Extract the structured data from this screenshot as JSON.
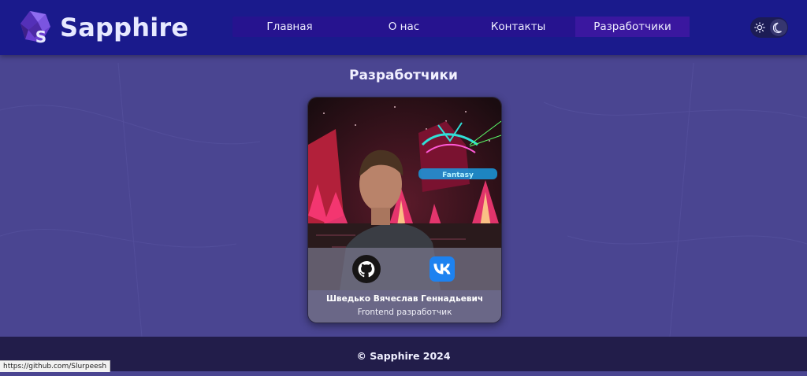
{
  "app": {
    "name": "Sapphire"
  },
  "nav": {
    "items": [
      {
        "label": "Главная"
      },
      {
        "label": "О нас"
      },
      {
        "label": "Контакты"
      },
      {
        "label": "Разработчики",
        "active": true
      }
    ]
  },
  "theme_switch": {
    "light_icon": "sun-icon",
    "dark_icon": "moon-icon"
  },
  "main": {
    "title": "Разработчики",
    "developers": [
      {
        "name": "Шведько Вячеслав Геннадьевич",
        "role": "Frontend разработчик",
        "socials": [
          {
            "icon": "github-icon"
          },
          {
            "icon": "vk-icon"
          }
        ]
      }
    ]
  },
  "footer": {
    "text": "© Sapphire 2024"
  },
  "status_bar": {
    "url": "https://github.com/Slurpeesh"
  },
  "colors": {
    "header": "#1a1a8c",
    "nav": "#26138f",
    "page_bg": "#4a4591",
    "footer": "#221d4a",
    "vk": "#1d82f0"
  }
}
